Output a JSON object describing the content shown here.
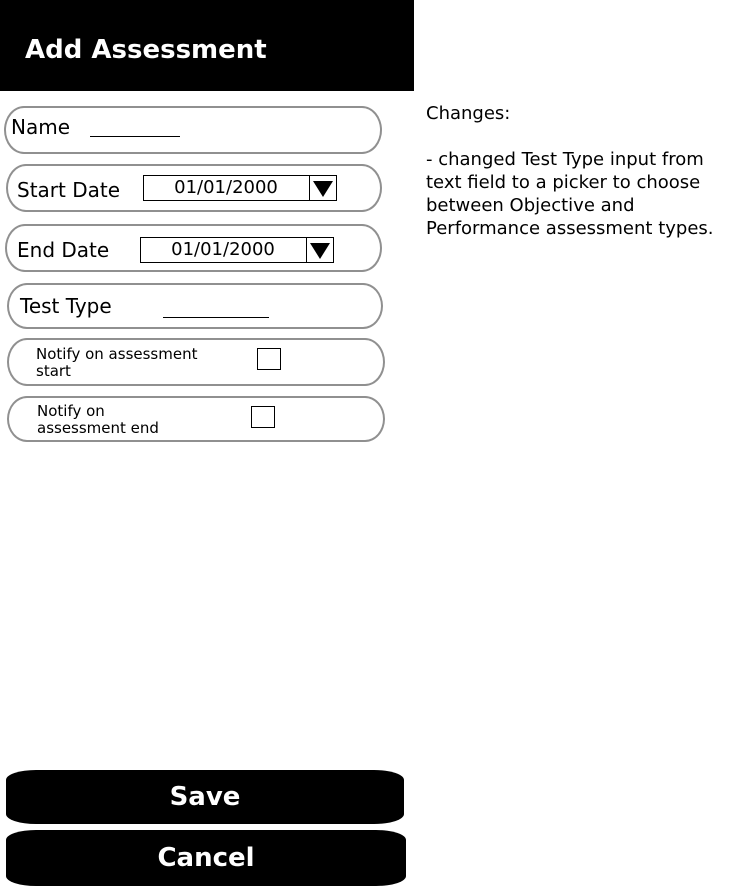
{
  "header": {
    "title": "Add Assessment"
  },
  "form": {
    "name": {
      "label": "Name"
    },
    "start_date": {
      "label": "Start Date",
      "value": "01/01/2000"
    },
    "end_date": {
      "label": "End Date",
      "value": "01/01/2000"
    },
    "test_type": {
      "label": "Test Type"
    },
    "notify_start": {
      "label": "Notify on assessment start",
      "checked": false
    },
    "notify_end": {
      "label": "Notify on assessment end",
      "checked": false
    }
  },
  "buttons": {
    "save": "Save",
    "cancel": "Cancel"
  },
  "notes": {
    "title": "Changes:",
    "body": "- changed Test Type input from text field to a picker to choose between Objective and Performance assessment types."
  }
}
